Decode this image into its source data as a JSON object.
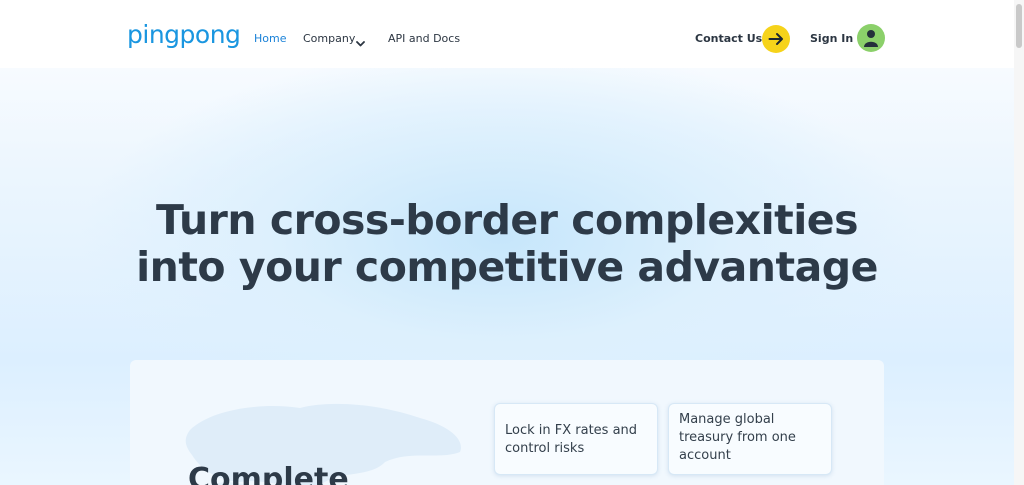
{
  "header": {
    "logo": "pingpong",
    "nav": {
      "home": "Home",
      "company": "Company",
      "api": "API and Docs"
    },
    "contact_label": "Contact Us",
    "signin_label": "Sign In"
  },
  "hero": {
    "headline_line1": "Turn cross-border complexities",
    "headline_line2": "into your competitive advantage"
  },
  "card": {
    "title": "Complete",
    "features": [
      {
        "text": "Lock in FX rates and control risks"
      },
      {
        "text": "Manage global treasury from one account"
      }
    ]
  },
  "colors": {
    "brand": "#1a96e0",
    "accent_yellow": "#f6d31a",
    "avatar_green": "#8bd06a",
    "headline": "#2d3a48"
  },
  "icons": [
    "chevron-down-icon",
    "arrow-right-icon",
    "user-icon",
    "world-map-icon"
  ]
}
